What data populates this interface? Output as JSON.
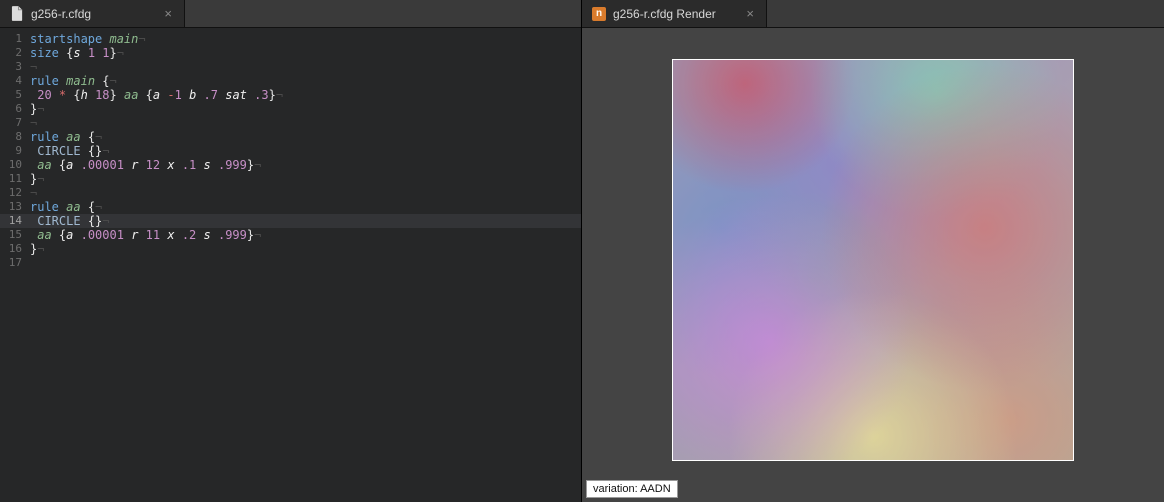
{
  "tabs": {
    "left": {
      "title": "g256-r.cfdg"
    },
    "right": {
      "title": "g256-r.cfdg Render",
      "icon_letter": "n"
    }
  },
  "editor": {
    "highlighted_line_index": 13,
    "lines": [
      {
        "n": "1",
        "t": [
          [
            "kw",
            "startshape"
          ],
          [
            "pn",
            " "
          ],
          [
            "str",
            "main"
          ],
          [
            "eol",
            "¬"
          ]
        ]
      },
      {
        "n": "2",
        "t": [
          [
            "kw",
            "size"
          ],
          [
            "pn",
            " {"
          ],
          [
            "prop",
            "s"
          ],
          [
            "pn",
            " "
          ],
          [
            "np",
            "1"
          ],
          [
            "pn",
            " "
          ],
          [
            "np",
            "1"
          ],
          [
            "pn",
            "}"
          ],
          [
            "eol",
            "¬"
          ]
        ]
      },
      {
        "n": "3",
        "t": [
          [
            "eol",
            "¬"
          ]
        ]
      },
      {
        "n": "4",
        "t": [
          [
            "kw",
            "rule"
          ],
          [
            "pn",
            " "
          ],
          [
            "str",
            "main"
          ],
          [
            "pn",
            " {"
          ],
          [
            "eol",
            "¬"
          ]
        ]
      },
      {
        "n": "5",
        "t": [
          [
            "pn",
            " "
          ],
          [
            "np",
            "20"
          ],
          [
            "pn",
            " "
          ],
          [
            "op",
            "*"
          ],
          [
            "pn",
            " {"
          ],
          [
            "prop",
            "h"
          ],
          [
            "pn",
            " "
          ],
          [
            "np",
            "18"
          ],
          [
            "pn",
            "} "
          ],
          [
            "str",
            "aa"
          ],
          [
            "pn",
            " {"
          ],
          [
            "prop",
            "a"
          ],
          [
            "pn",
            " "
          ],
          [
            "op",
            "-"
          ],
          [
            "np",
            "1"
          ],
          [
            "pn",
            " "
          ],
          [
            "prop",
            "b"
          ],
          [
            "pn",
            " "
          ],
          [
            "np",
            ".7"
          ],
          [
            "pn",
            " "
          ],
          [
            "prop",
            "sat"
          ],
          [
            "pn",
            " "
          ],
          [
            "np",
            ".3"
          ],
          [
            "pn",
            "}"
          ],
          [
            "eol",
            "¬"
          ]
        ]
      },
      {
        "n": "6",
        "t": [
          [
            "pn",
            "}"
          ],
          [
            "eol",
            "¬"
          ]
        ]
      },
      {
        "n": "7",
        "t": [
          [
            "eol",
            "¬"
          ]
        ]
      },
      {
        "n": "8",
        "t": [
          [
            "kw",
            "rule"
          ],
          [
            "pn",
            " "
          ],
          [
            "str",
            "aa"
          ],
          [
            "pn",
            " {"
          ],
          [
            "eol",
            "¬"
          ]
        ]
      },
      {
        "n": "9",
        "t": [
          [
            "pn",
            " "
          ],
          [
            "shp",
            "CIRCLE"
          ],
          [
            "pn",
            " {}"
          ],
          [
            "eol",
            "¬"
          ]
        ]
      },
      {
        "n": "10",
        "t": [
          [
            "pn",
            " "
          ],
          [
            "str",
            "aa"
          ],
          [
            "pn",
            " {"
          ],
          [
            "prop",
            "a"
          ],
          [
            "pn",
            " "
          ],
          [
            "np",
            ".00001"
          ],
          [
            "pn",
            " "
          ],
          [
            "prop",
            "r"
          ],
          [
            "pn",
            " "
          ],
          [
            "np",
            "12"
          ],
          [
            "pn",
            " "
          ],
          [
            "prop",
            "x"
          ],
          [
            "pn",
            " "
          ],
          [
            "np",
            ".1"
          ],
          [
            "pn",
            " "
          ],
          [
            "prop",
            "s"
          ],
          [
            "pn",
            " "
          ],
          [
            "np",
            ".999"
          ],
          [
            "pn",
            "}"
          ],
          [
            "eol",
            "¬"
          ]
        ]
      },
      {
        "n": "11",
        "t": [
          [
            "pn",
            "}"
          ],
          [
            "eol",
            "¬"
          ]
        ]
      },
      {
        "n": "12",
        "t": [
          [
            "eol",
            "¬"
          ]
        ]
      },
      {
        "n": "13",
        "t": [
          [
            "kw",
            "rule"
          ],
          [
            "pn",
            " "
          ],
          [
            "str",
            "aa"
          ],
          [
            "pn",
            " {"
          ],
          [
            "eol",
            "¬"
          ]
        ]
      },
      {
        "n": "14",
        "t": [
          [
            "pn",
            " "
          ],
          [
            "shp",
            "CIRCLE"
          ],
          [
            "pn",
            " {}"
          ],
          [
            "eol",
            "¬"
          ]
        ]
      },
      {
        "n": "15",
        "t": [
          [
            "pn",
            " "
          ],
          [
            "str",
            "aa"
          ],
          [
            "pn",
            " {"
          ],
          [
            "prop",
            "a"
          ],
          [
            "pn",
            " "
          ],
          [
            "np",
            ".00001"
          ],
          [
            "pn",
            " "
          ],
          [
            "prop",
            "r"
          ],
          [
            "pn",
            " "
          ],
          [
            "np",
            "11"
          ],
          [
            "pn",
            " "
          ],
          [
            "prop",
            "x"
          ],
          [
            "pn",
            " "
          ],
          [
            "np",
            ".2"
          ],
          [
            "pn",
            " "
          ],
          [
            "prop",
            "s"
          ],
          [
            "pn",
            " "
          ],
          [
            "np",
            ".999"
          ],
          [
            "pn",
            "}"
          ],
          [
            "eol",
            "¬"
          ]
        ]
      },
      {
        "n": "16",
        "t": [
          [
            "pn",
            "}"
          ],
          [
            "eol",
            "¬"
          ]
        ]
      },
      {
        "n": "17",
        "t": []
      }
    ]
  },
  "render": {
    "status_label": "variation: AADN"
  }
}
